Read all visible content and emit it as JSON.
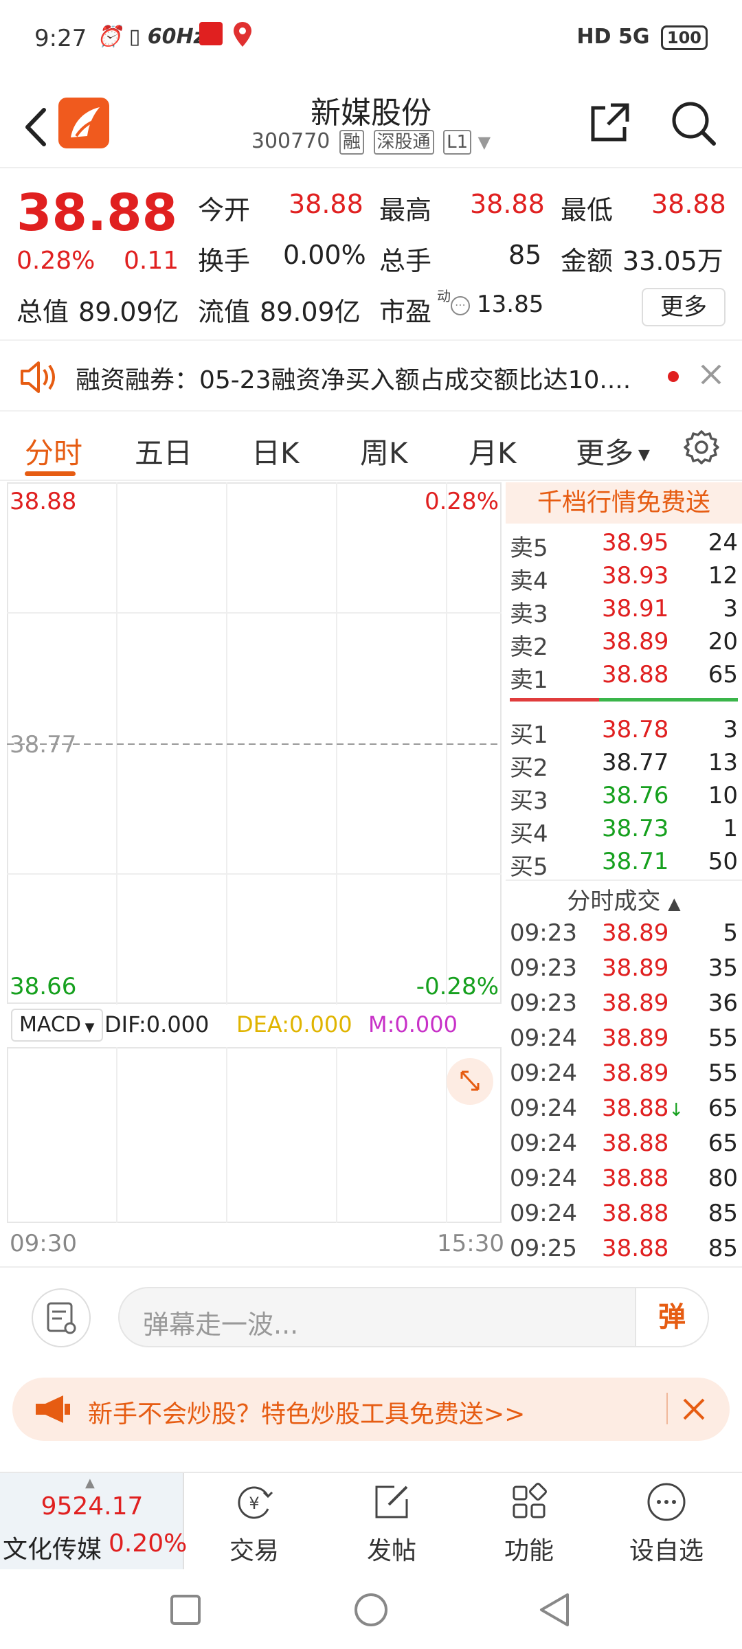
{
  "status_bar": {
    "time": "9:27",
    "refresh": "60Hz",
    "signal": "HD 5G",
    "battery": "100"
  },
  "header": {
    "title": "新媒股份",
    "code": "300770",
    "tags": [
      "融",
      "深股通",
      "L1"
    ]
  },
  "quote": {
    "price": "38.88",
    "change_pct": "0.28%",
    "change": "0.11",
    "rows": [
      [
        {
          "label": "今开",
          "value": "38.88",
          "color": "red"
        },
        {
          "label": "最高",
          "value": "38.88",
          "color": "red"
        },
        {
          "label": "最低",
          "value": "38.88",
          "color": "red"
        }
      ],
      [
        {
          "label": "换手",
          "value": "0.00%",
          "color": "blk"
        },
        {
          "label": "总手",
          "value": "85",
          "color": "blk"
        },
        {
          "label": "金额",
          "value": "33.05万",
          "color": "blk"
        }
      ],
      [
        {
          "label": "总值",
          "value": "89.09亿",
          "color": "blk"
        },
        {
          "label": "流值",
          "value": "89.09亿",
          "color": "blk"
        },
        {
          "label": "市盈",
          "value": "13.85",
          "color": "blk",
          "sup": "动"
        }
      ]
    ],
    "more_label": "更多"
  },
  "notice": {
    "text": "融资融券：05-23融资净买入额占成交额比达10...."
  },
  "tabs": [
    "分时",
    "五日",
    "日K",
    "周K",
    "月K",
    "更多"
  ],
  "chart": {
    "top_left": "38.88",
    "top_right": "0.28%",
    "mid": "38.77",
    "bottom_left": "38.66",
    "bottom_right": "-0.28%",
    "time_start": "09:30",
    "time_end": "15:30"
  },
  "macd": {
    "selector": "MACD",
    "dif": "DIF:0.000",
    "dea": "DEA:0.000",
    "m": "M:0.000"
  },
  "order_book": {
    "banner": "千档行情免费送",
    "sell": [
      {
        "n": "卖5",
        "p": "38.95",
        "v": "24"
      },
      {
        "n": "卖4",
        "p": "38.93",
        "v": "12"
      },
      {
        "n": "卖3",
        "p": "38.91",
        "v": "3"
      },
      {
        "n": "卖2",
        "p": "38.89",
        "v": "20"
      },
      {
        "n": "卖1",
        "p": "38.88",
        "v": "65"
      }
    ],
    "buy": [
      {
        "n": "买1",
        "p": "38.78",
        "v": "3",
        "c": "red"
      },
      {
        "n": "买2",
        "p": "38.77",
        "v": "13",
        "c": "blk"
      },
      {
        "n": "买3",
        "p": "38.76",
        "v": "10",
        "c": "green"
      },
      {
        "n": "买4",
        "p": "38.73",
        "v": "1",
        "c": "green"
      },
      {
        "n": "买5",
        "p": "38.71",
        "v": "50",
        "c": "green"
      }
    ],
    "trades_title": "分时成交",
    "trades": [
      {
        "t": "09:23",
        "p": "38.89",
        "v": "5",
        "vc": "blk"
      },
      {
        "t": "09:23",
        "p": "38.89",
        "v": "35",
        "vc": "blk"
      },
      {
        "t": "09:23",
        "p": "38.89",
        "v": "36",
        "vc": "blk"
      },
      {
        "t": "09:24",
        "p": "38.89",
        "v": "55",
        "vc": "blk"
      },
      {
        "t": "09:24",
        "p": "38.89",
        "v": "55",
        "vc": "blk"
      },
      {
        "t": "09:24",
        "p": "38.88",
        "v": "65",
        "vc": "blk",
        "arrow": "↓"
      },
      {
        "t": "09:24",
        "p": "38.88",
        "v": "65",
        "vc": "blk"
      },
      {
        "t": "09:24",
        "p": "38.88",
        "v": "80",
        "vc": "blk"
      },
      {
        "t": "09:24",
        "p": "38.88",
        "v": "85",
        "vc": "blk"
      },
      {
        "t": "09:25",
        "p": "38.88",
        "v": "85",
        "vc": "red"
      }
    ]
  },
  "comment": {
    "placeholder": "弹幕走一波...",
    "send": "弹"
  },
  "promo": {
    "text": "新手不会炒股？特色炒股工具免费送>>"
  },
  "toolbar": {
    "index_value": "9524.17",
    "index_name": "文化传媒",
    "index_pct": "0.20%",
    "items": [
      {
        "label": "交易",
        "icon": "yen-cycle-icon"
      },
      {
        "label": "发帖",
        "icon": "edit-icon"
      },
      {
        "label": "功能",
        "icon": "grid-icon"
      },
      {
        "label": "设自选",
        "icon": "more-circle-icon"
      }
    ]
  },
  "colors": {
    "accent": "#e65c12",
    "up": "#e02020",
    "down": "#16a01e"
  }
}
